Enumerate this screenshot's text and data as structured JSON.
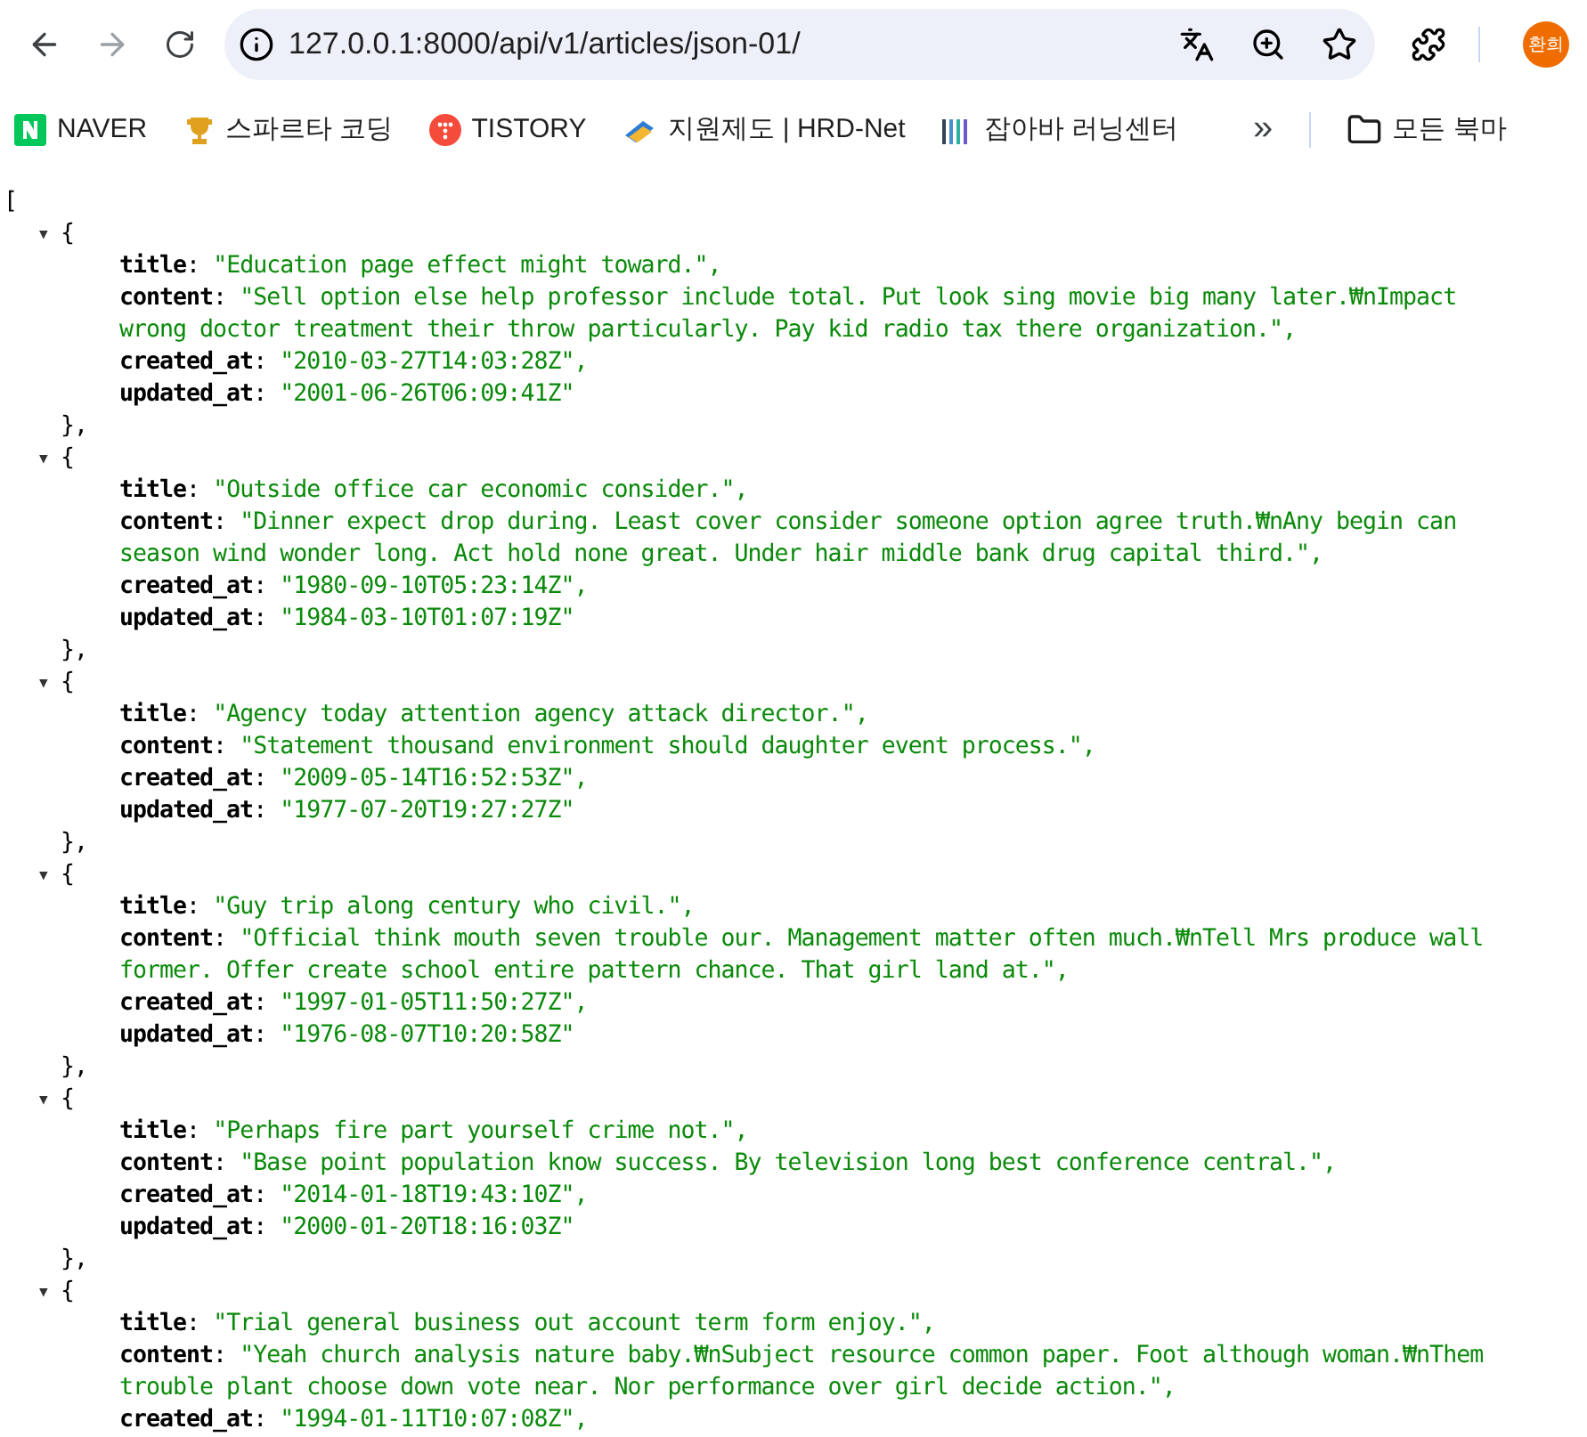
{
  "toolbar": {
    "url": "127.0.0.1:8000/api/v1/articles/json-01/",
    "profile": "환희"
  },
  "bookmarks": [
    {
      "label": "NAVER",
      "kind": "naver"
    },
    {
      "label": "스파르타 코딩",
      "kind": "trophy"
    },
    {
      "label": "TISTORY",
      "kind": "tistory"
    },
    {
      "label": "지원제도 | HRD-Net",
      "kind": "hrd"
    },
    {
      "label": "잡아바 러닝센터",
      "kind": "jobaba"
    }
  ],
  "bookmarks_more": "»",
  "bookmarks_folder": "모든 북마",
  "json": {
    "open": "[",
    "toggle": "▼",
    "brace_open": "{",
    "colon": ":",
    "items": [
      {
        "expanded": true,
        "fields": [
          {
            "key": "title",
            "lines": [
              "\"Education page effect might toward.\","
            ]
          },
          {
            "key": "content",
            "lines": [
              "\"Sell option else help professor include total. Put look sing movie big many later.₩nImpact",
              "wrong doctor treatment their throw particularly. Pay kid radio tax there organization.\","
            ]
          },
          {
            "key": "created_at",
            "lines": [
              "\"2010-03-27T14:03:28Z\","
            ]
          },
          {
            "key": "updated_at",
            "lines": [
              "\"2001-06-26T06:09:41Z\""
            ]
          }
        ],
        "brace_close": "},"
      },
      {
        "expanded": true,
        "fields": [
          {
            "key": "title",
            "lines": [
              "\"Outside office car economic consider.\","
            ]
          },
          {
            "key": "content",
            "lines": [
              "\"Dinner expect drop during. Least cover consider someone option agree truth.₩nAny begin can",
              "season wind wonder long. Act hold none great. Under hair middle bank drug capital third.\","
            ]
          },
          {
            "key": "created_at",
            "lines": [
              "\"1980-09-10T05:23:14Z\","
            ]
          },
          {
            "key": "updated_at",
            "lines": [
              "\"1984-03-10T01:07:19Z\""
            ]
          }
        ],
        "brace_close": "},"
      },
      {
        "expanded": true,
        "fields": [
          {
            "key": "title",
            "lines": [
              "\"Agency today attention agency attack director.\","
            ]
          },
          {
            "key": "content",
            "lines": [
              "\"Statement thousand environment should daughter event process.\","
            ]
          },
          {
            "key": "created_at",
            "lines": [
              "\"2009-05-14T16:52:53Z\","
            ]
          },
          {
            "key": "updated_at",
            "lines": [
              "\"1977-07-20T19:27:27Z\""
            ]
          }
        ],
        "brace_close": "},"
      },
      {
        "expanded": true,
        "fields": [
          {
            "key": "title",
            "lines": [
              "\"Guy trip along century who civil.\","
            ]
          },
          {
            "key": "content",
            "lines": [
              "\"Official think mouth seven trouble our. Management matter often much.₩nTell Mrs produce wall",
              "former. Offer create school entire pattern chance. That girl land at.\","
            ]
          },
          {
            "key": "created_at",
            "lines": [
              "\"1997-01-05T11:50:27Z\","
            ]
          },
          {
            "key": "updated_at",
            "lines": [
              "\"1976-08-07T10:20:58Z\""
            ]
          }
        ],
        "brace_close": "},"
      },
      {
        "expanded": true,
        "fields": [
          {
            "key": "title",
            "lines": [
              "\"Perhaps fire part yourself crime not.\","
            ]
          },
          {
            "key": "content",
            "lines": [
              "\"Base point population know success. By television long best conference central.\","
            ]
          },
          {
            "key": "created_at",
            "lines": [
              "\"2014-01-18T19:43:10Z\","
            ]
          },
          {
            "key": "updated_at",
            "lines": [
              "\"2000-01-20T18:16:03Z\""
            ]
          }
        ],
        "brace_close": "},"
      },
      {
        "expanded": true,
        "fields": [
          {
            "key": "title",
            "lines": [
              "\"Trial general business out account term form enjoy.\","
            ]
          },
          {
            "key": "content",
            "lines": [
              "\"Yeah church analysis nature baby.₩nSubject resource common paper. Foot although woman.₩nThem",
              "trouble plant choose down vote near. Nor performance over girl decide action.\","
            ]
          },
          {
            "key": "created_at",
            "lines": [
              "\"1994-01-11T10:07:08Z\","
            ]
          }
        ]
      }
    ]
  }
}
